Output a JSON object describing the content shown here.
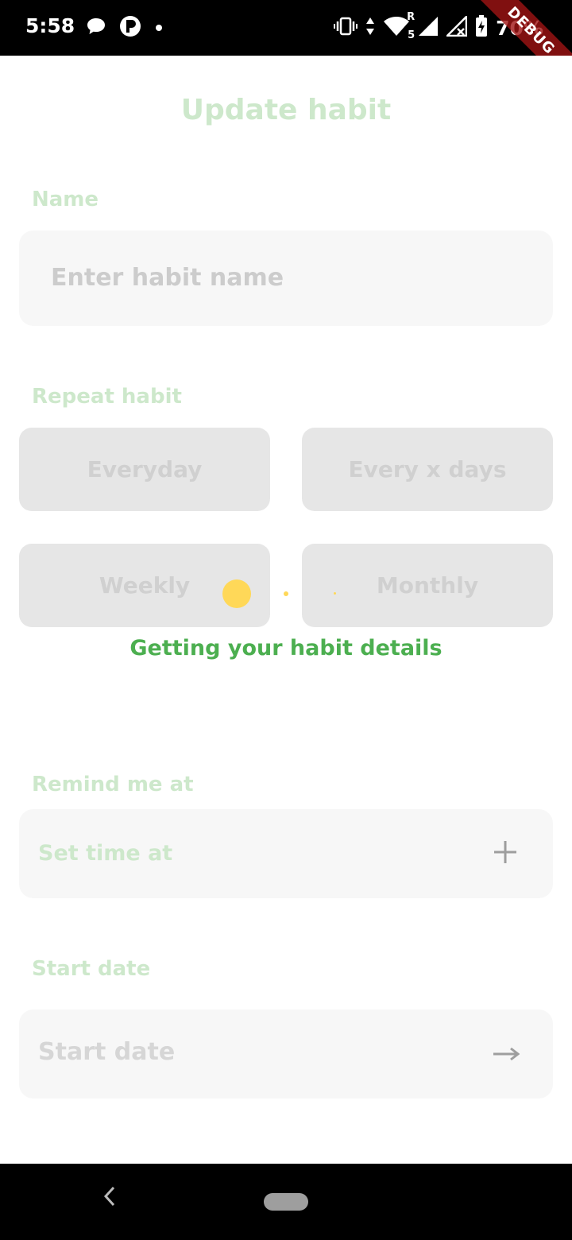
{
  "status_bar": {
    "time": "5:58",
    "battery": "70%",
    "network_label": "R",
    "signal_label": "5",
    "icons": [
      "chat-bubble-icon",
      "p-app-icon",
      "dot-icon",
      "vibrate-icon",
      "data-arrows-icon",
      "wifi-icon",
      "signal-icon",
      "signal-no-data-icon",
      "battery-icon"
    ]
  },
  "debug_banner": "DEBUG",
  "page": {
    "title": "Update habit"
  },
  "name_section": {
    "label": "Name",
    "placeholder": "Enter habit name"
  },
  "repeat_section": {
    "label": "Repeat habit",
    "options": [
      "Everyday",
      "Every x days",
      "Weekly",
      "Monthly"
    ]
  },
  "loading": {
    "message": "Getting your habit details",
    "dot_color": "#ffd858"
  },
  "remind_section": {
    "label": "Remind me at",
    "field_text": "Set time at",
    "add_icon": "plus-icon"
  },
  "start_section": {
    "label": "Start date",
    "field_text": "Start date",
    "arrow_icon": "arrow-right-icon"
  },
  "nav": {
    "back_icon": "back-chevron-icon",
    "home_icon": "home-pill-icon"
  },
  "colors": {
    "accent_green": "#4caf50",
    "faded_green": "#cde8cb",
    "field_bg": "#f7f7f7",
    "option_bg": "#e6e6e6"
  }
}
